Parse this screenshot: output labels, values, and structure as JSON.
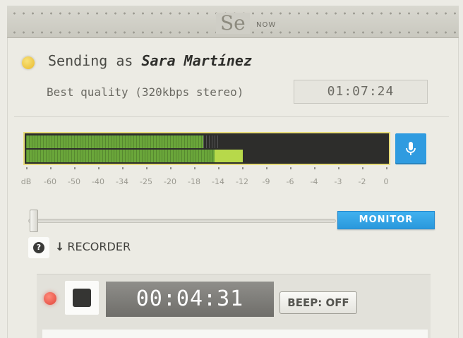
{
  "header": {
    "logo_text": "Se",
    "logo_sub": "NOW"
  },
  "status": {
    "label": "Sending as ",
    "user_name": "Sara Martínez",
    "indicator_color": "#e9b92a",
    "quality": "Best quality (320kbps stereo)",
    "elapsed": "01:07:24"
  },
  "level_meter": {
    "scale_labels": [
      "dB",
      "-60",
      "-50",
      "-40",
      "-34",
      "-25",
      "-20",
      "-18",
      "-14",
      "-12",
      "-9",
      "-6",
      "-4",
      "-3",
      "-2",
      "0"
    ],
    "left_level_fraction": 0.49,
    "right_level_fraction": 0.6,
    "colors": {
      "active": "#6aa63a",
      "hot": "#b7d94a",
      "border": "#e7dc7a"
    }
  },
  "mic_button": {
    "icon": "microphone-icon",
    "color": "#2f9be0"
  },
  "monitor": {
    "button_label": "MONITOR",
    "volume_fraction": 0.0
  },
  "help": {
    "icon": "question-icon"
  },
  "recorder": {
    "toggle_label": "RECORDER",
    "toggle_icon": "arrow-down-icon",
    "timer": "00:04:31",
    "beep_label": "BEEP: OFF",
    "recording_color": "#e0453b"
  }
}
